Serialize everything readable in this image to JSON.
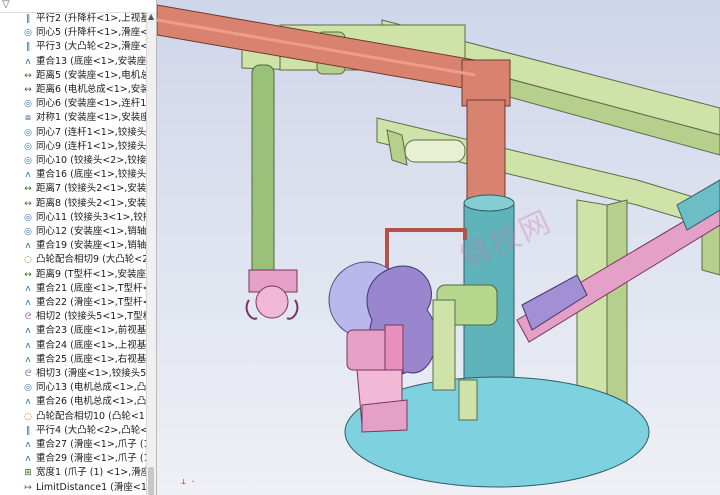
{
  "feature_tree": {
    "filter_icon": "filter-icon",
    "items": [
      {
        "icon": "parallel-mate-icon",
        "glyph": "∥",
        "cls": "sym",
        "label": "平行2 (升降杆<1>,上视基准"
      },
      {
        "icon": "concentric-mate-icon",
        "glyph": "◎",
        "cls": "coin",
        "label": "同心5 (升降杆<1>,滑座<1"
      },
      {
        "icon": "parallel-mate-icon",
        "glyph": "∥",
        "cls": "sym",
        "label": "平行3 (大凸轮<2>,滑座<1"
      },
      {
        "icon": "coincident-mate-icon",
        "glyph": "ʌ",
        "cls": "coin",
        "label": "重合13 (底座<1>,安装座<"
      },
      {
        "icon": "distance-mate-icon",
        "glyph": "↔",
        "cls": "dist",
        "label": "距离5 (安装座<1>,电机总成"
      },
      {
        "icon": "distance-mate-icon",
        "glyph": "↔",
        "cls": "dist",
        "label": "距离6 (电机总成<1>,安装座"
      },
      {
        "icon": "concentric-mate-icon",
        "glyph": "◎",
        "cls": "coin",
        "label": "同心6 (安装座<1>,连杆1<"
      },
      {
        "icon": "symmetric-mate-icon",
        "glyph": "⧈",
        "cls": "sym",
        "label": "对称1 (安装座<1>,安装座<"
      },
      {
        "icon": "concentric-mate-icon",
        "glyph": "◎",
        "cls": "coin",
        "label": "同心7 (连杆1<1>,铰接头5"
      },
      {
        "icon": "concentric-mate-icon",
        "glyph": "◎",
        "cls": "coin",
        "label": "同心9 (连杆1<1>,铰接头<"
      },
      {
        "icon": "concentric-mate-icon",
        "glyph": "◎",
        "cls": "coin",
        "label": "同心10 (铰接头<2>,铰接头"
      },
      {
        "icon": "coincident-mate-icon",
        "glyph": "ʌ",
        "cls": "coin",
        "label": "重合16 (底座<1>,铰接头2"
      },
      {
        "icon": "distance-mate-icon",
        "glyph": "↔",
        "cls": "dist",
        "label": "距离7 (铰接头2<1>,安装座"
      },
      {
        "icon": "distance-mate-icon",
        "glyph": "↔",
        "cls": "dist",
        "label": "距离8 (铰接头2<1>,安装座"
      },
      {
        "icon": "concentric-mate-icon",
        "glyph": "◎",
        "cls": "coin",
        "label": "同心11 (铰接头3<1>,铰接"
      },
      {
        "icon": "concentric-mate-icon",
        "glyph": "◎",
        "cls": "coin",
        "label": "同心12 (安装座<1>,销轴<"
      },
      {
        "icon": "coincident-mate-icon",
        "glyph": "ʌ",
        "cls": "coin",
        "label": "重合19 (安装座<1>,销轴<"
      },
      {
        "icon": "cam-mate-icon",
        "glyph": "◌",
        "cls": "cam",
        "label": "凸轮配合相切9 (大凸轮<2:"
      },
      {
        "icon": "distance-mate-icon",
        "glyph": "↔",
        "cls": "dist",
        "label": "距离9 (T型杆<1>,安装座<"
      },
      {
        "icon": "coincident-mate-icon",
        "glyph": "ʌ",
        "cls": "coin",
        "label": "重合21 (底座<1>,T型杆<1"
      },
      {
        "icon": "coincident-mate-icon",
        "glyph": "ʌ",
        "cls": "coin",
        "label": "重合22 (滑座<1>,T型杆<1"
      },
      {
        "icon": "tangent-mate-icon",
        "glyph": "ᘓ",
        "cls": "tan",
        "label": "相切2 (铰接头5<1>,T型杆"
      },
      {
        "icon": "coincident-mate-icon",
        "glyph": "ʌ",
        "cls": "coin",
        "label": "重合23 (底座<1>,前视基准"
      },
      {
        "icon": "coincident-mate-icon",
        "glyph": "ʌ",
        "cls": "coin",
        "label": "重合24 (底座<1>,上视基准"
      },
      {
        "icon": "coincident-mate-icon",
        "glyph": "ʌ",
        "cls": "coin",
        "label": "重合25 (底座<1>,右视基准"
      },
      {
        "icon": "tangent-mate-icon",
        "glyph": "ᘓ",
        "cls": "tan",
        "label": "相切3 (滑座<1>,铰接头5<"
      },
      {
        "icon": "concentric-mate-icon",
        "glyph": "◎",
        "cls": "coin",
        "label": "同心13 (电机总成<1>,凸轮"
      },
      {
        "icon": "coincident-mate-icon",
        "glyph": "ʌ",
        "cls": "coin",
        "label": "重合26 (电机总成<1>,凸轮"
      },
      {
        "icon": "cam-mate-icon",
        "glyph": "◌",
        "cls": "cam",
        "label": "凸轮配合相切10 (凸轮<1>"
      },
      {
        "icon": "parallel-mate-icon",
        "glyph": "∥",
        "cls": "sym",
        "label": "平行4 (大凸轮<2>,凸轮<1"
      },
      {
        "icon": "coincident-mate-icon",
        "glyph": "ʌ",
        "cls": "coin",
        "label": "重合27 (滑座<1>,爪子 (1"
      },
      {
        "icon": "coincident-mate-icon",
        "glyph": "ʌ",
        "cls": "coin",
        "label": "重合29 (滑座<1>,爪子 (1"
      },
      {
        "icon": "width-mate-icon",
        "glyph": "⊞",
        "cls": "dist",
        "label": "宽度1 (爪子 (1) <1>,滑座"
      },
      {
        "icon": "limit-distance-icon",
        "glyph": "↦",
        "cls": "dist",
        "label": "LimitDistance1 (滑座<1>,"
      }
    ]
  },
  "viewport": {
    "watermark": "锦技网",
    "triad_label": "⊥ ·"
  },
  "colors": {
    "salmon": "#d9826f",
    "pale_green": "#cfe3a9",
    "teal": "#5fb3ba",
    "purple": "#9a86cf",
    "pink": "#e4a0c6",
    "base": "#7ed2e0"
  }
}
